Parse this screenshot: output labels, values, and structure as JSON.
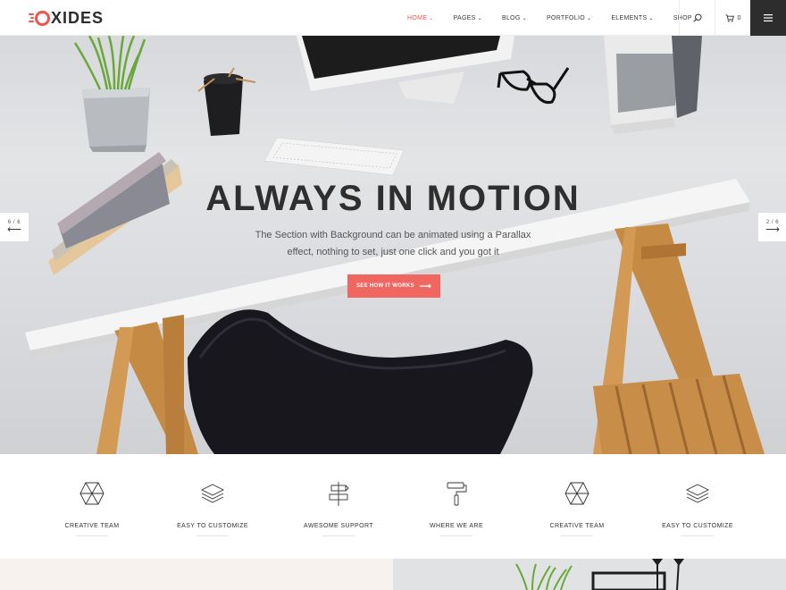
{
  "brand": {
    "name": "XIDES",
    "accent": "#f0524c"
  },
  "nav": {
    "items": [
      {
        "label": "HOME",
        "active": true
      },
      {
        "label": "PAGES",
        "active": false
      },
      {
        "label": "BLOG",
        "active": false
      },
      {
        "label": "PORTFOLIO",
        "active": false
      },
      {
        "label": "ELEMENTS",
        "active": false
      },
      {
        "label": "SHOP",
        "active": false
      }
    ],
    "cart_count": "0",
    "icons": {
      "search": "search-icon",
      "cart": "cart-icon",
      "menu": "hamburger-icon"
    }
  },
  "hero": {
    "title": "ALWAYS IN MOTION",
    "subtitle": "The Section with Background can be animated using a Parallax effect, nothing to set, just one click and you got it",
    "cta": "SEE HOW IT WORKS",
    "prev_count": "6 / 6",
    "next_count": "2 / 6",
    "button_color": "#f06661"
  },
  "features": [
    {
      "label": "CREATIVE TEAM",
      "icon": "hexagon-icon"
    },
    {
      "label": "EASY TO CUSTOMIZE",
      "icon": "layers-icon"
    },
    {
      "label": "AWESOME SUPPORT",
      "icon": "signpost-icon"
    },
    {
      "label": "WHERE WE ARE",
      "icon": "paint-roller-icon"
    },
    {
      "label": "CREATIVE TEAM",
      "icon": "hexagon-icon"
    },
    {
      "label": "EASY TO CUSTOMIZE",
      "icon": "layers-icon"
    }
  ]
}
